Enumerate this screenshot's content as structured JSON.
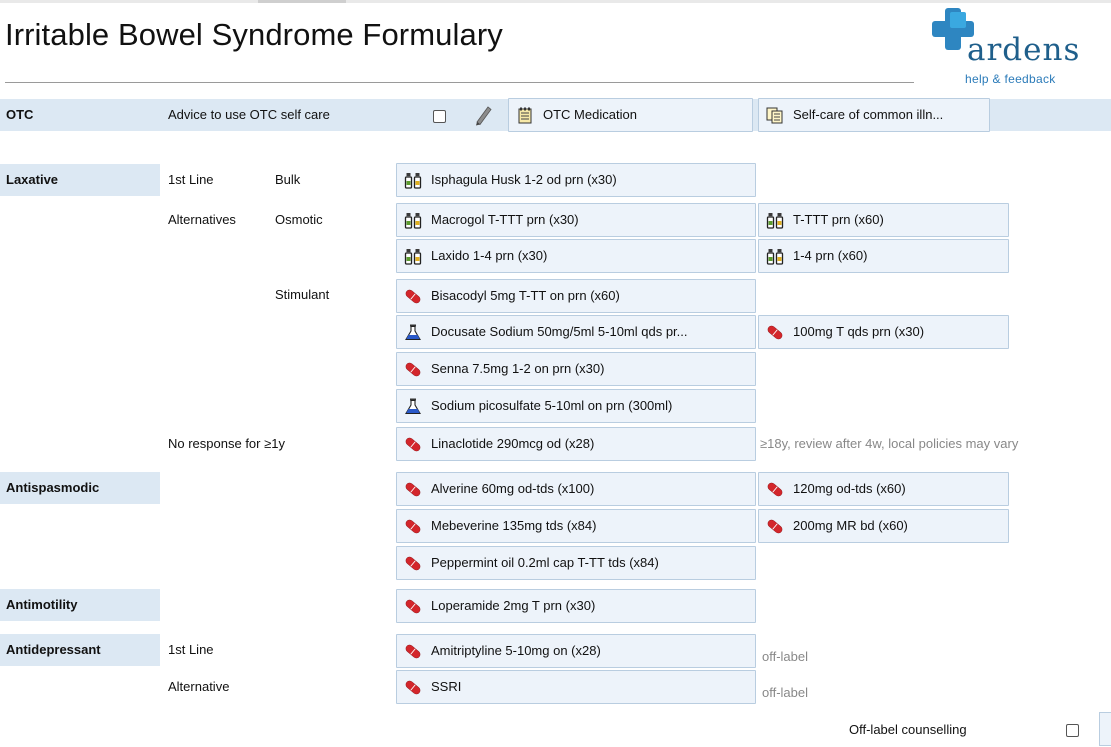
{
  "page": {
    "title": "Irritable Bowel Syndrome Formulary",
    "logo_text": "ardens",
    "help_text": "help & feedback"
  },
  "otc": {
    "category": "OTC",
    "advice_label": "Advice to use OTC self care",
    "medication_button": "OTC Medication",
    "selfcare_button": "Self-care of common illn..."
  },
  "laxative": {
    "category": "Laxative",
    "first_line": "1st Line",
    "alternatives": "Alternatives",
    "bulk": "Bulk",
    "osmotic": "Osmotic",
    "stimulant": "Stimulant",
    "no_response": "No response for ≥1y",
    "linaclotide_note": "≥18y, review after 4w, local policies may vary",
    "items": {
      "isphagula": "Isphagula Husk 1-2 od prn (x30)",
      "macrogol": "Macrogol T-TTT prn (x30)",
      "macrogol_alt": "T-TTT prn (x60)",
      "laxido": "Laxido 1-4 prn (x30)",
      "laxido_alt": "1-4 prn (x60)",
      "bisacodyl": "Bisacodyl 5mg T-TT on prn (x60)",
      "docusate": "Docusate Sodium 50mg/5ml 5-10ml qds pr...",
      "docusate_alt": "100mg T qds prn (x30)",
      "senna": "Senna 7.5mg 1-2 on prn (x30)",
      "picosulfate": "Sodium picosulfate 5-10ml on prn (300ml)",
      "linaclotide": "Linaclotide 290mcg od (x28)"
    }
  },
  "antispasmodic": {
    "category": "Antispasmodic",
    "items": {
      "alverine": "Alverine 60mg od-tds (x100)",
      "alverine_alt": "120mg od-tds (x60)",
      "mebeverine": "Mebeverine 135mg tds (x84)",
      "mebeverine_alt": "200mg MR bd (x60)",
      "peppermint": "Peppermint oil 0.2ml cap T-TT tds (x84)"
    }
  },
  "antimotility": {
    "category": "Antimotility",
    "items": {
      "loperamide": "Loperamide 2mg T prn (x30)"
    }
  },
  "antidepressant": {
    "category": "Antidepressant",
    "first_line": "1st Line",
    "alternative": "Alternative",
    "off_label": "off-label",
    "items": {
      "amitriptyline": "Amitriptyline 5-10mg on (x28)",
      "ssri": "SSRI"
    }
  },
  "footer": {
    "counselling_label": "Off-label counselling"
  },
  "colors": {
    "category_bg": "#dce8f3",
    "button_bg": "#edf3fa",
    "button_border": "#b9cde0",
    "capsule_red": "#d3262b",
    "note_grey": "#888888",
    "brand_blue": "#2e86c1"
  },
  "icons": [
    "capsule-icon",
    "bottle-icon",
    "flask-icon",
    "pencil-icon",
    "notepad-icon",
    "document-icon",
    "ardens-cross-icon"
  ]
}
